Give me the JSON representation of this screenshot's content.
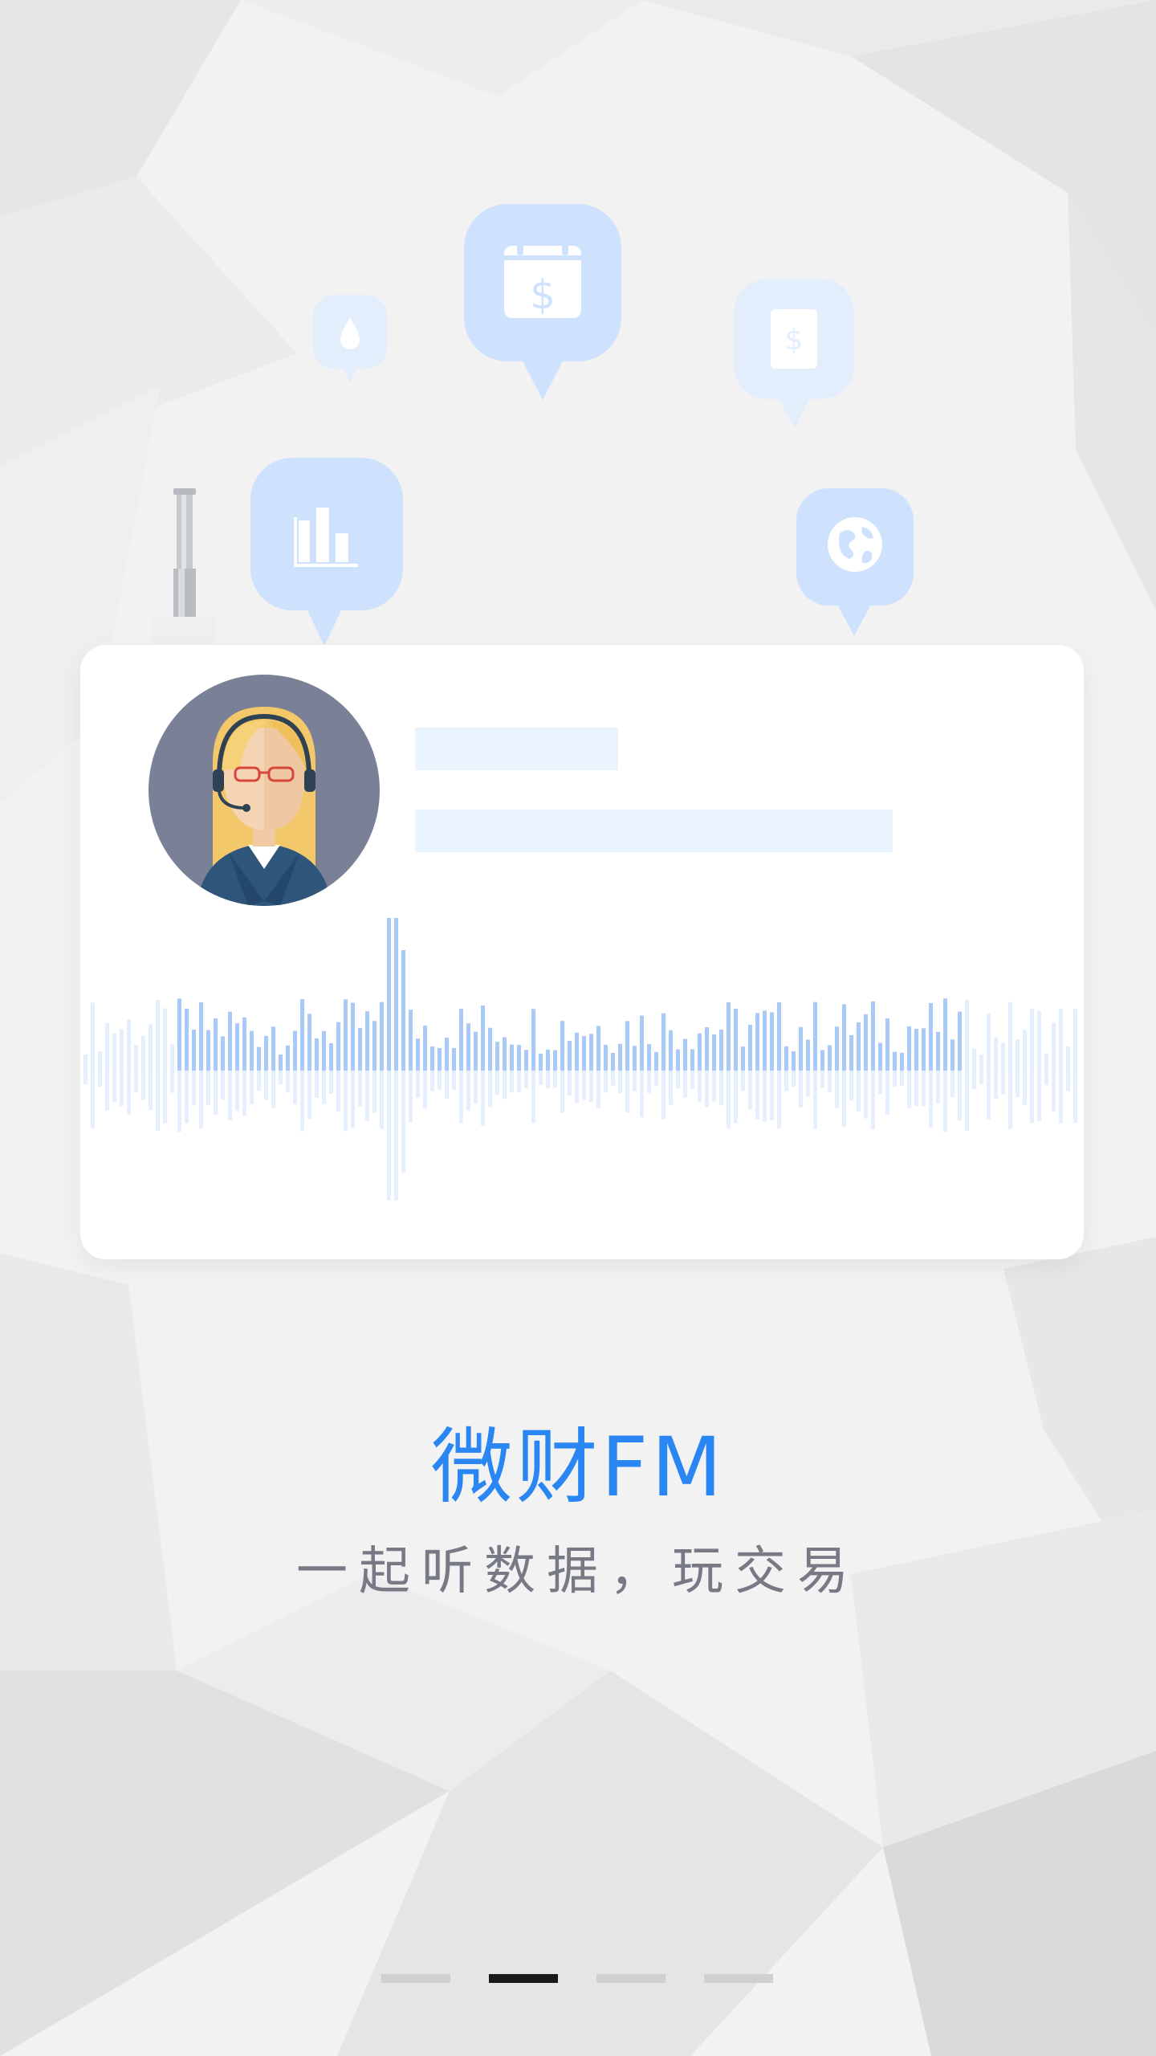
{
  "app": {
    "title": "微财FM",
    "subtitle": "一起听数据，玩交易"
  },
  "floating_icons": [
    {
      "name": "water-drop-icon"
    },
    {
      "name": "calendar-dollar-icon"
    },
    {
      "name": "dollar-document-icon"
    },
    {
      "name": "bar-chart-icon"
    },
    {
      "name": "globe-icon"
    }
  ],
  "colors": {
    "accent": "#2a86f2",
    "subtitle": "#777a84",
    "bubble": "#cfe2fd",
    "bubble_faded": "#e3eefd",
    "wave": "#a9c9f7",
    "placeholder": "#eaf4fe"
  },
  "pager": {
    "count": 4,
    "active_index": 1
  }
}
